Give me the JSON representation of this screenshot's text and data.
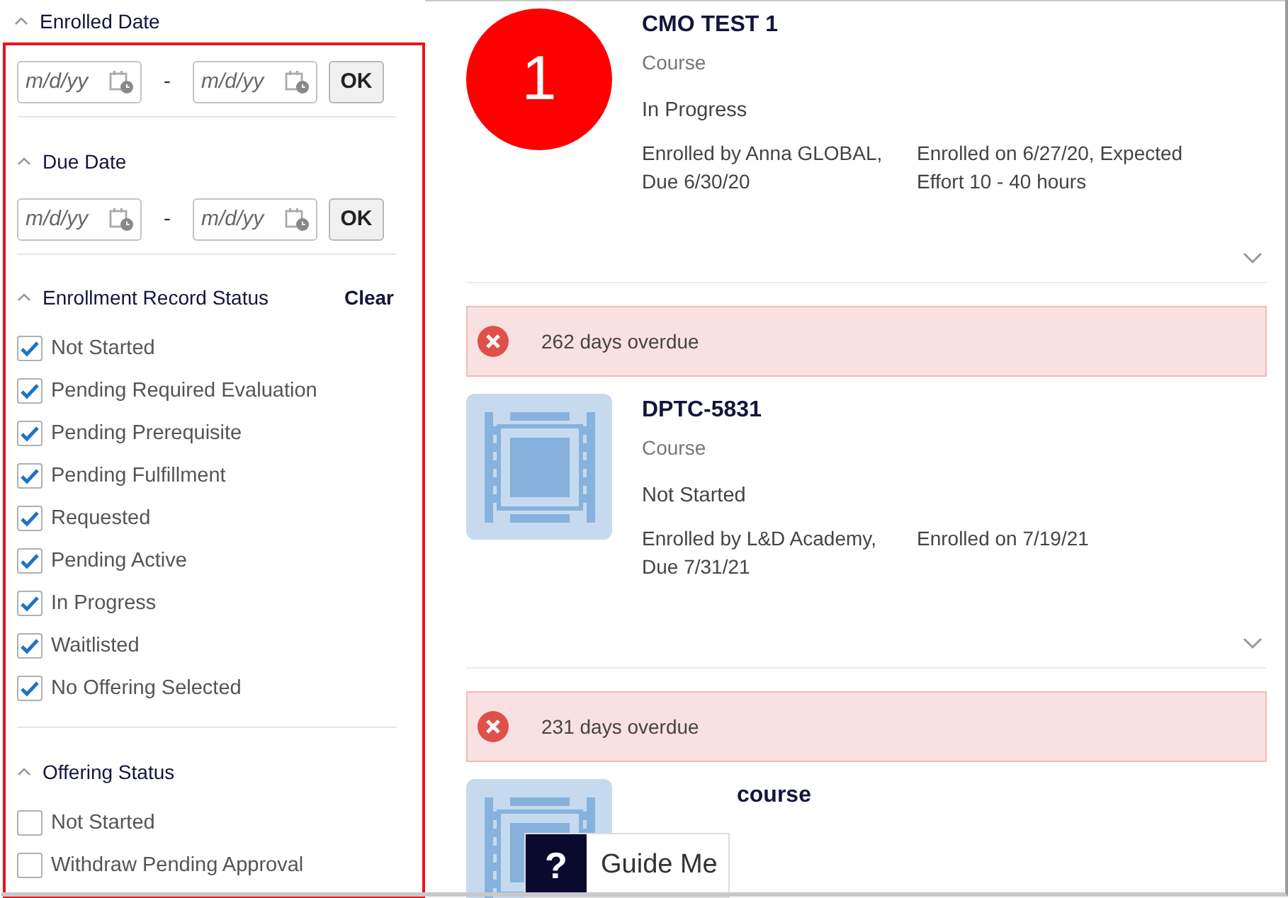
{
  "filters": [
    {
      "kind": "date",
      "title": "Enrolled Date",
      "expanded": true,
      "from_placeholder": "m/d/yy",
      "separator": "-",
      "to_placeholder": "m/d/yy",
      "button": "OK"
    },
    {
      "kind": "date",
      "title": "Due Date",
      "expanded": true,
      "from_placeholder": "m/d/yy",
      "separator": "-",
      "to_placeholder": "m/d/yy",
      "button": "OK"
    },
    {
      "kind": "checklist",
      "title": "Enrollment Record Status",
      "expanded": true,
      "action": "Clear",
      "options": [
        {
          "label": "Not Started",
          "checked": true
        },
        {
          "label": "Pending Required Evaluation",
          "checked": true
        },
        {
          "label": "Pending Prerequisite",
          "checked": true
        },
        {
          "label": "Pending Fulfillment",
          "checked": true
        },
        {
          "label": "Requested",
          "checked": true
        },
        {
          "label": "Pending Active",
          "checked": true
        },
        {
          "label": "In Progress",
          "checked": true
        },
        {
          "label": "Waitlisted",
          "checked": true
        },
        {
          "label": "No Offering Selected",
          "checked": true
        }
      ]
    },
    {
      "kind": "checklist",
      "title": "Offering Status",
      "expanded": true,
      "options": [
        {
          "label": "Not Started",
          "checked": false
        },
        {
          "label": "Withdraw Pending Approval",
          "checked": false
        }
      ]
    }
  ],
  "courses": [
    {
      "kind": "number",
      "thumb_text": "1",
      "title": "CMO TEST 1",
      "type": "Course",
      "status": "In Progress",
      "enrolled_by": "Enrolled by Anna GLOBAL, Due 6/30/20",
      "enrolled_on": "Enrolled on 6/27/20, Expected Effort 10 - 40 hours"
    },
    {
      "alert": "262 days overdue",
      "kind": "film",
      "title": "DPTC-5831",
      "type": "Course",
      "status": "Not Started",
      "enrolled_by": "Enrolled by L&D Academy, Due 7/31/21",
      "enrolled_on": "Enrolled on 7/19/21"
    },
    {
      "alert": "231 days overdue",
      "kind": "film",
      "title": "course"
    }
  ],
  "guide": {
    "icon_text": "?",
    "label": "Guide Me"
  }
}
